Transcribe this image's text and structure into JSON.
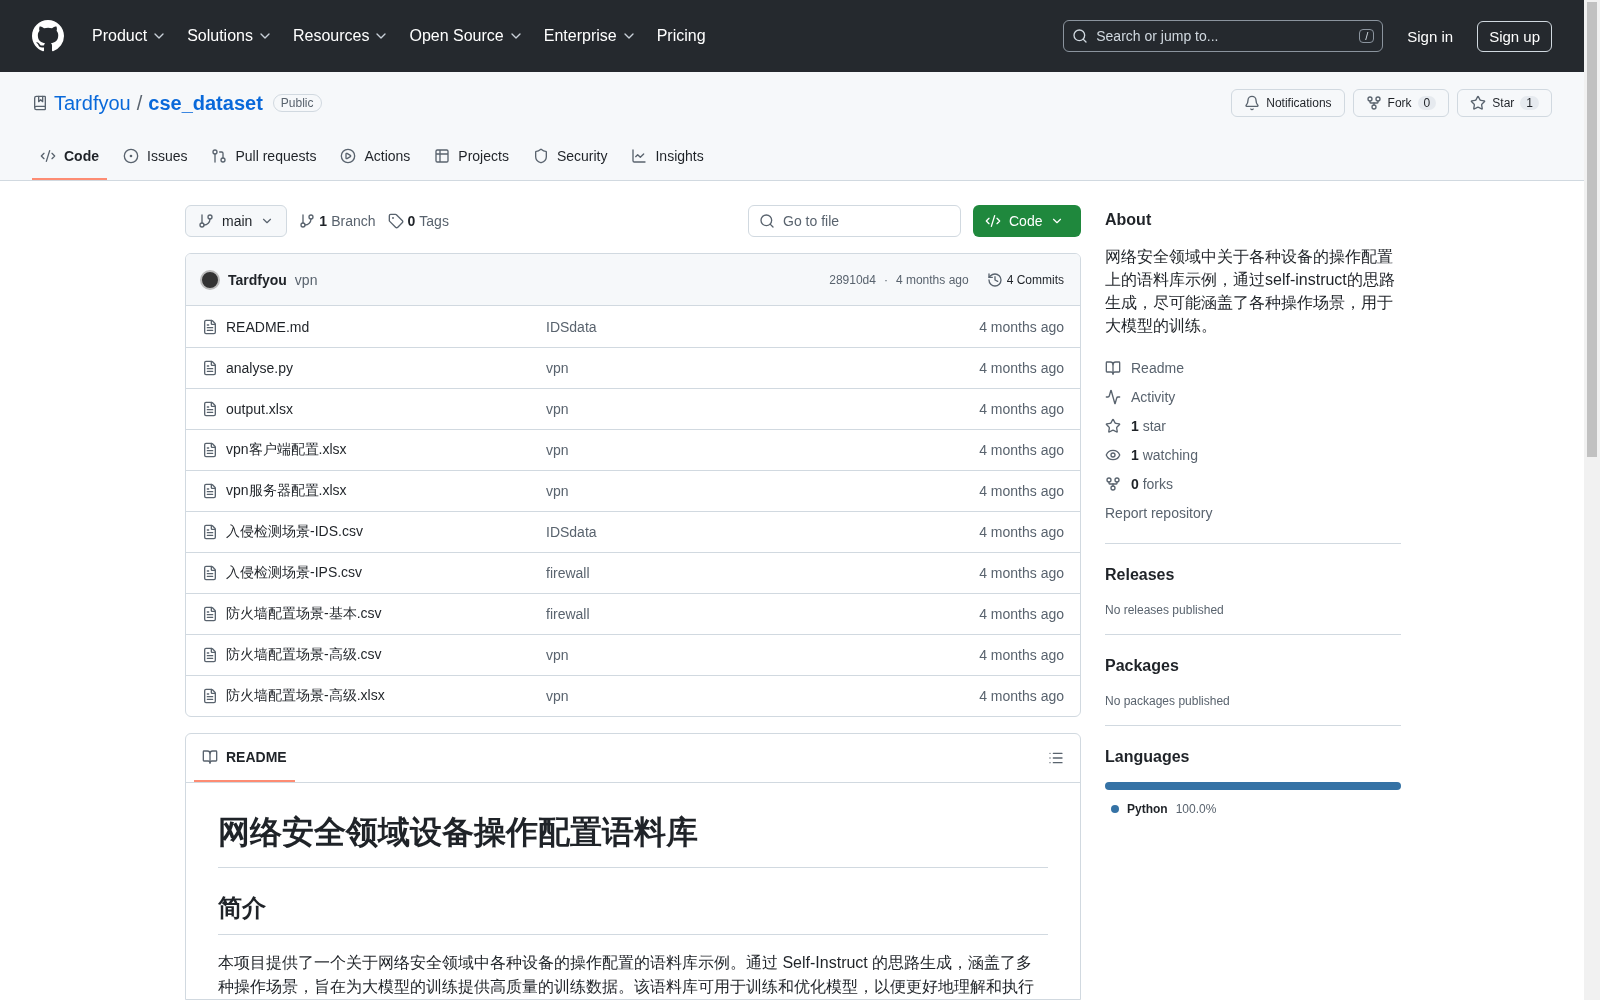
{
  "nav": {
    "menus": [
      {
        "label": "Product",
        "dropdown": true
      },
      {
        "label": "Solutions",
        "dropdown": true
      },
      {
        "label": "Resources",
        "dropdown": true
      },
      {
        "label": "Open Source",
        "dropdown": true
      },
      {
        "label": "Enterprise",
        "dropdown": true
      },
      {
        "label": "Pricing",
        "dropdown": false
      }
    ],
    "search": {
      "placeholder": "Search or jump to...",
      "shortcut": "/"
    },
    "sign_in": "Sign in",
    "sign_up": "Sign up"
  },
  "repo": {
    "owner": "Tardfyou",
    "separator": "/",
    "name": "cse_dataset",
    "visibility": "Public",
    "actions": [
      {
        "kind": "bell",
        "label": "Notifications"
      },
      {
        "kind": "fork",
        "label": "Fork",
        "count": "0"
      },
      {
        "kind": "star",
        "label": "Star",
        "count": "1"
      }
    ]
  },
  "tabs": [
    {
      "kind": "code",
      "label": "Code",
      "selected": true
    },
    {
      "kind": "issues",
      "label": "Issues",
      "selected": false
    },
    {
      "kind": "pulls",
      "label": "Pull requests",
      "selected": false
    },
    {
      "kind": "actions",
      "label": "Actions",
      "selected": false
    },
    {
      "kind": "projects",
      "label": "Projects",
      "selected": false
    },
    {
      "kind": "security",
      "label": "Security",
      "selected": false
    },
    {
      "kind": "insights",
      "label": "Insights",
      "selected": false
    }
  ],
  "toolbar": {
    "branch": "main",
    "branches_count": "1",
    "branches_label": "Branch",
    "tags_count": "0",
    "tags_label": "Tags",
    "go_to_file": "Go to file",
    "code_button": "Code"
  },
  "commit": {
    "author": "Tardfyou",
    "message": "vpn",
    "hash": "28910d4",
    "separator": "·",
    "time": "4 months ago",
    "commits": "4 Commits"
  },
  "files": [
    {
      "name": "README.md",
      "message": "IDSdata",
      "time": "4 months ago"
    },
    {
      "name": "analyse.py",
      "message": "vpn",
      "time": "4 months ago"
    },
    {
      "name": "output.xlsx",
      "message": "vpn",
      "time": "4 months ago"
    },
    {
      "name": "vpn客户端配置.xlsx",
      "message": "vpn",
      "time": "4 months ago"
    },
    {
      "name": "vpn服务器配置.xlsx",
      "message": "vpn",
      "time": "4 months ago"
    },
    {
      "name": "入侵检测场景-IDS.csv",
      "message": "IDSdata",
      "time": "4 months ago"
    },
    {
      "name": "入侵检测场景-IPS.csv",
      "message": "firewall",
      "time": "4 months ago"
    },
    {
      "name": "防火墙配置场景-基本.csv",
      "message": "firewall",
      "time": "4 months ago"
    },
    {
      "name": "防火墙配置场景-高级.csv",
      "message": "vpn",
      "time": "4 months ago"
    },
    {
      "name": "防火墙配置场景-高级.xlsx",
      "message": "vpn",
      "time": "4 months ago"
    }
  ],
  "readme": {
    "tab": "README",
    "title": "网络安全领域设备操作配置语料库",
    "section": "简介",
    "paragraph": "本项目提供了一个关于网络安全领域中各种设备的操作配置的语料库示例。通过 Self-Instruct 的思路生成，涵盖了多种操作场景，旨在为大模型的训练提供高质量的训练数据。该语料库可用于训练和优化模型，以便更好地理解和执行"
  },
  "about": {
    "title": "About",
    "description": "网络安全领域中关于各种设备的操作配置上的语料库示例，通过self-instruct的思路生成，尽可能涵盖了各种操作场景，用于大模型的训练。",
    "links": [
      {
        "kind": "book",
        "label": "Readme"
      },
      {
        "kind": "pulse",
        "label": "Activity"
      },
      {
        "kind": "star",
        "count": "1",
        "label": "star"
      },
      {
        "kind": "eye",
        "count": "1",
        "label": "watching"
      },
      {
        "kind": "fork",
        "count": "0",
        "label": "forks"
      }
    ],
    "report": "Report repository"
  },
  "releases": {
    "title": "Releases",
    "note": "No releases published"
  },
  "packages": {
    "title": "Packages",
    "note": "No packages published"
  },
  "languages": {
    "title": "Languages",
    "items": [
      {
        "name": "Python",
        "percent": "100.0%",
        "level": 1.0,
        "color": "#3572a5"
      }
    ]
  }
}
